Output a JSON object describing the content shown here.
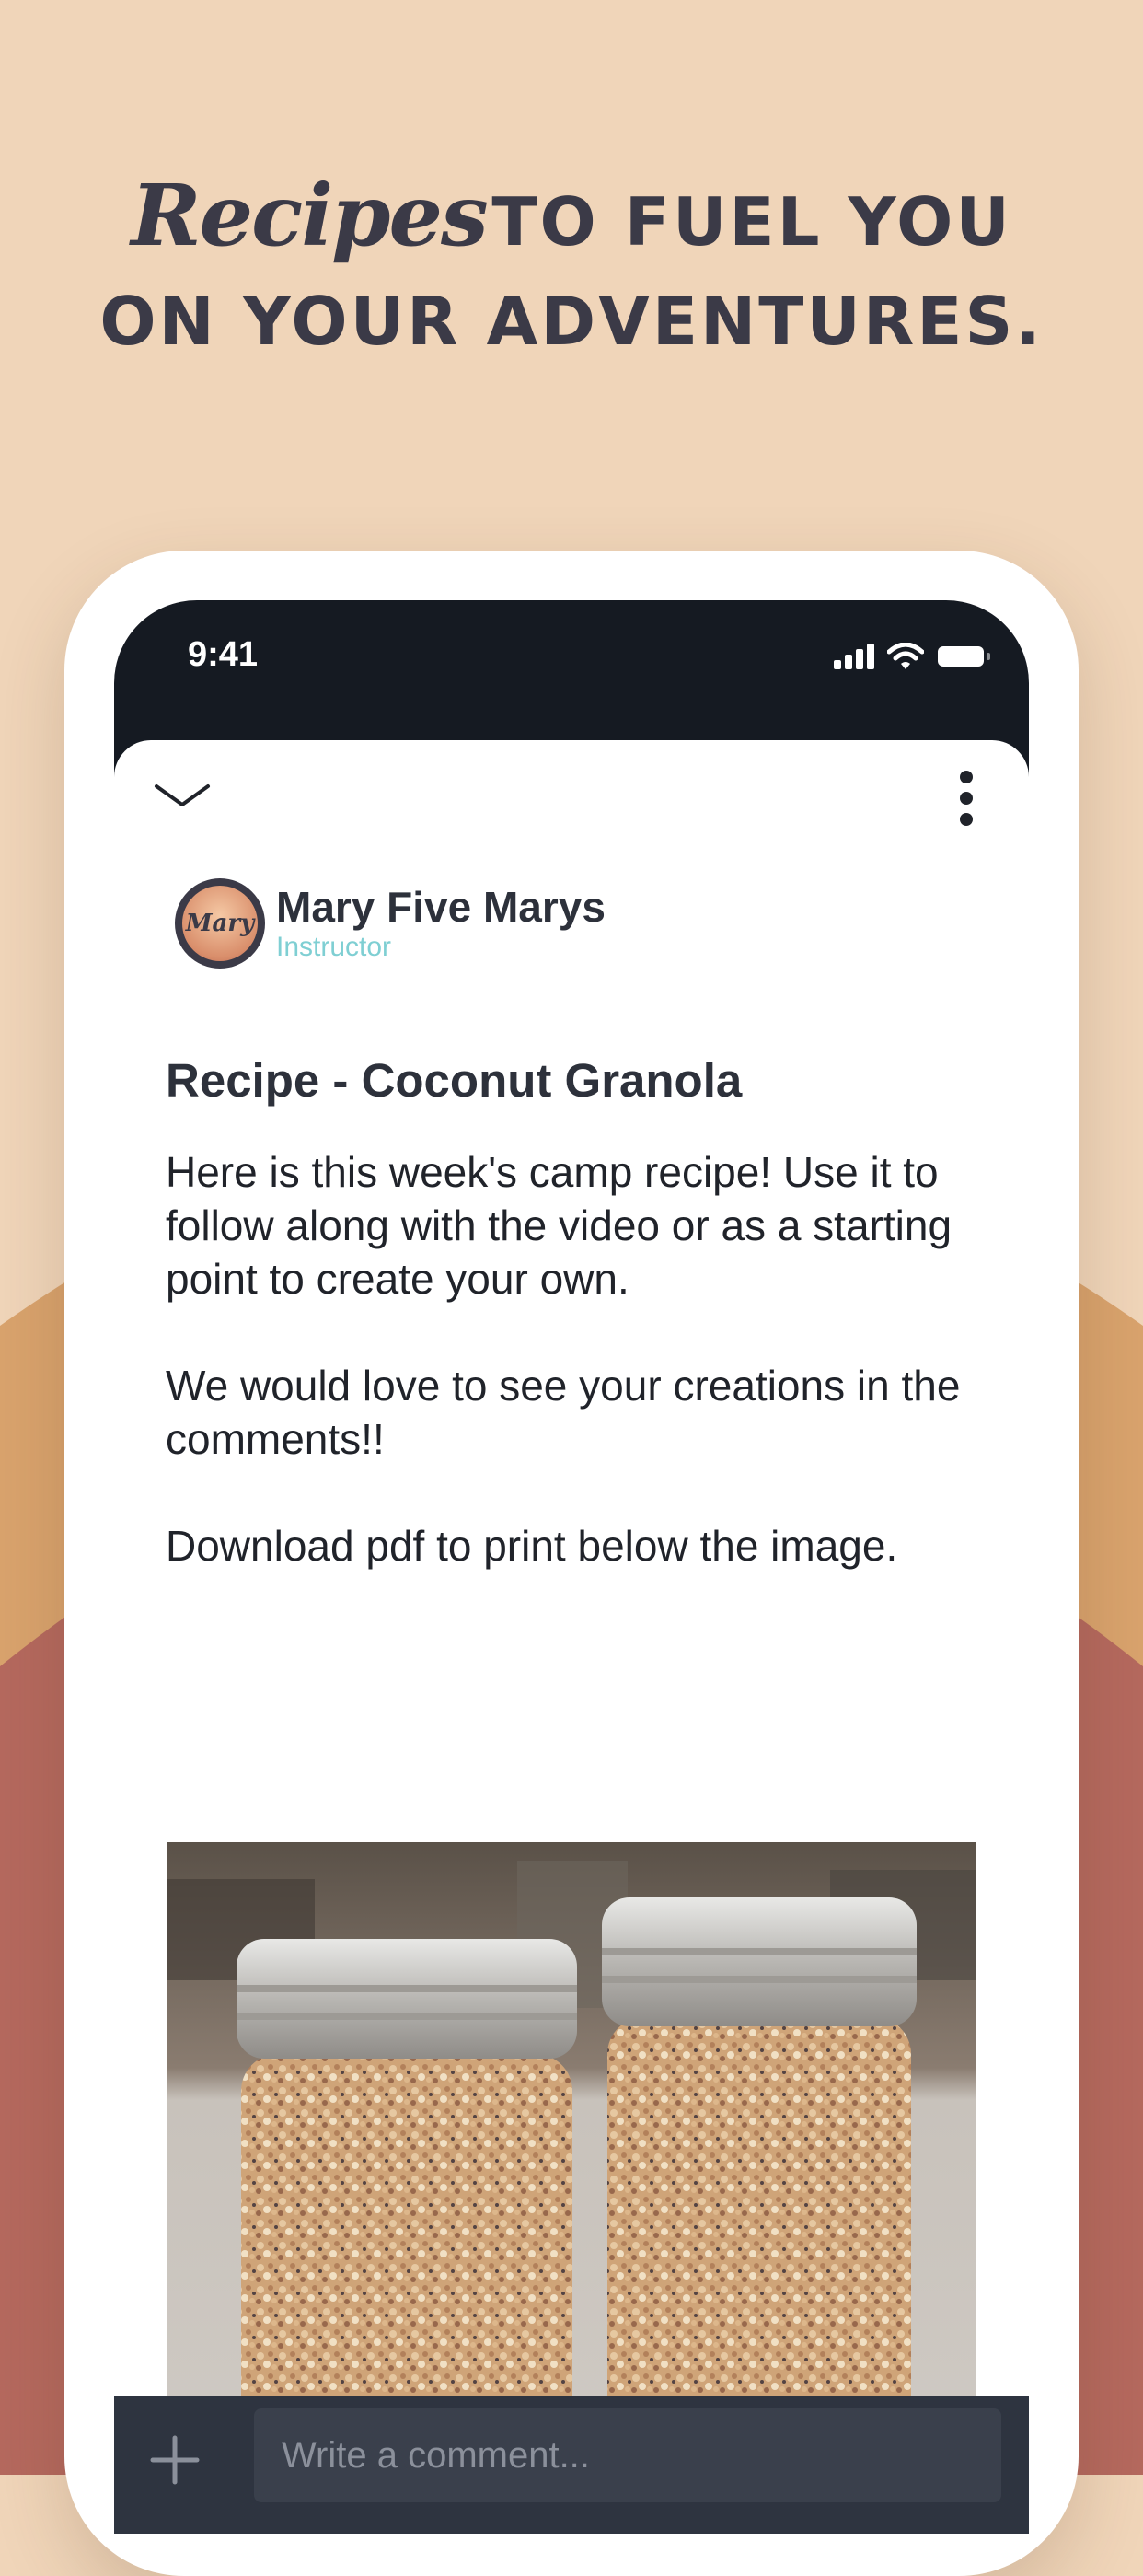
{
  "headline": {
    "script_word": "Recipes",
    "line1_rest": "TO FUEL YOU",
    "line2": "ON YOUR ADVENTURES."
  },
  "status_bar": {
    "time": "9:41",
    "icons": [
      "signal-icon",
      "wifi-icon",
      "battery-icon"
    ]
  },
  "post_header": {
    "collapse_icon": "chevron-down-icon",
    "menu_icon": "more-vertical-icon"
  },
  "author": {
    "name": "Mary Five Marys",
    "role": "Instructor",
    "avatar_text": "Mary"
  },
  "post": {
    "title": "Recipe - Coconut Granola",
    "paragraphs": [
      "Here is this week's camp recipe! Use it to follow along with the video or as a starting point to create your own.",
      "We would love to see your creations in the comments!!",
      "Download pdf to print below the image."
    ]
  },
  "comment_bar": {
    "add_icon": "plus-icon",
    "placeholder": "Write a comment..."
  },
  "colors": {
    "background": "#f0d5b9",
    "wave_orange": "#d9a36d",
    "wave_red": "#b5695e",
    "text_dark": "#2d313b",
    "accent_teal": "#7fcfd3",
    "comment_bar": "#2e3440"
  }
}
